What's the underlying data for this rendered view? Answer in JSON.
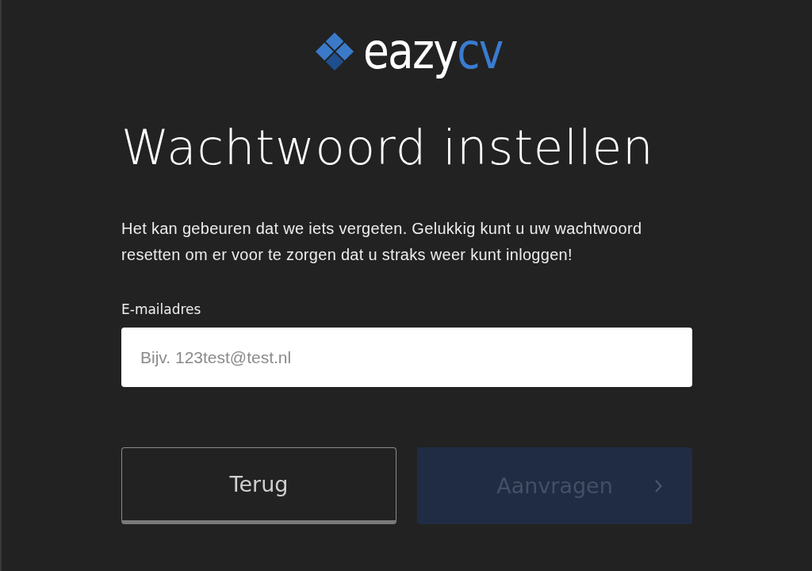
{
  "logo": {
    "text": "eazy",
    "accent": "cv"
  },
  "title": "Wachtwoord instellen",
  "intro": "Het kan gebeuren dat we iets vergeten. Gelukkig kunt u uw wachtwoord resetten om er voor te zorgen dat u straks weer kunt inloggen!",
  "email_field": {
    "label": "E-mailadres",
    "placeholder": "Bijv. 123test@test.nl"
  },
  "buttons": [
    {
      "label": "Terug",
      "kind": "secondary",
      "disabled": false
    },
    {
      "label": "Aanvragen",
      "kind": "primary",
      "disabled": true
    }
  ]
}
